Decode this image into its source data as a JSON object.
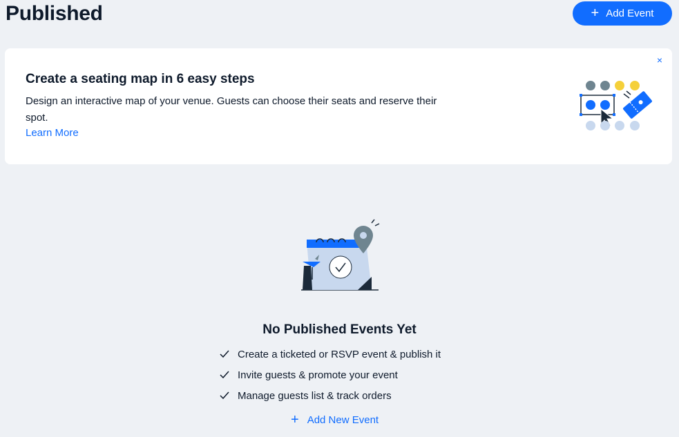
{
  "header": {
    "title": "Published",
    "add_event_label": "Add Event"
  },
  "banner": {
    "title": "Create a seating map in 6 easy steps",
    "description": "Design an interactive map of your venue. Guests can choose their seats and reserve their spot.",
    "link_label": "Learn More",
    "close_symbol": "×"
  },
  "empty_state": {
    "title": "No Published Events Yet",
    "items": [
      "Create a ticketed or RSVP event & publish it",
      "Invite guests & promote your event",
      "Manage guests list & track orders"
    ],
    "add_new_label": "Add New Event"
  },
  "icons": {
    "plus": "+",
    "close": "close-icon",
    "check": "check-icon"
  },
  "colors": {
    "accent": "#116dff",
    "background": "#eef1f5",
    "card": "#ffffff",
    "text": "#0e1a2b"
  }
}
